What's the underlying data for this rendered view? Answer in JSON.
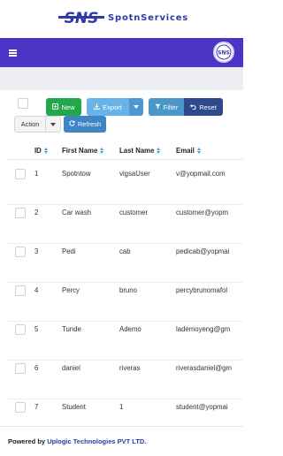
{
  "header": {
    "brand_name": "SpotnServices",
    "logo_text": "SNS",
    "avatar_text": "SNS"
  },
  "toolbar": {
    "new_label": "New",
    "export_label": "Export",
    "filter_label": "Filter",
    "reset_label": "Reset",
    "action_label": "Action",
    "refresh_label": "Refresh"
  },
  "table": {
    "columns": [
      "ID",
      "First Name",
      "Last Name",
      "Email"
    ],
    "rows": [
      {
        "id": "1",
        "first_name": "Spotntow",
        "last_name": "vigsaUser",
        "email": "v@yopmail.com"
      },
      {
        "id": "2",
        "first_name": "Car wash",
        "last_name": "customer",
        "email": "customer@yopm"
      },
      {
        "id": "3",
        "first_name": "Pedi",
        "last_name": "cab",
        "email": "pedicab@yopmai"
      },
      {
        "id": "4",
        "first_name": "Percy",
        "last_name": "bruno",
        "email": "percybrunomafol"
      },
      {
        "id": "5",
        "first_name": "Tunde",
        "last_name": "Ademo",
        "email": "lademoyeng@gm"
      },
      {
        "id": "6",
        "first_name": "daniel",
        "last_name": "riveras",
        "email": "riverasdaniel@gm"
      },
      {
        "id": "7",
        "first_name": "Student",
        "last_name": "1",
        "email": "student@yopmai"
      }
    ]
  },
  "footer": {
    "prefix": "Powered by ",
    "company": "Uplogic Technologies PVT LTD."
  },
  "colors": {
    "navbar": "#4a35c6",
    "brand": "#2d3aa8",
    "new_button": "#22a84b",
    "export_button": "#68b3e8",
    "filter_button": "#4a97c9",
    "reset_button": "#2c4a8c",
    "refresh_button": "#3f85c6",
    "sort_icon": "#3aa0d8"
  },
  "icons": {
    "menu": "hamburger-icon",
    "export": "download-icon",
    "filter": "funnel-icon",
    "reset": "undo-icon",
    "refresh": "refresh-icon",
    "sort": "sort-icon"
  }
}
